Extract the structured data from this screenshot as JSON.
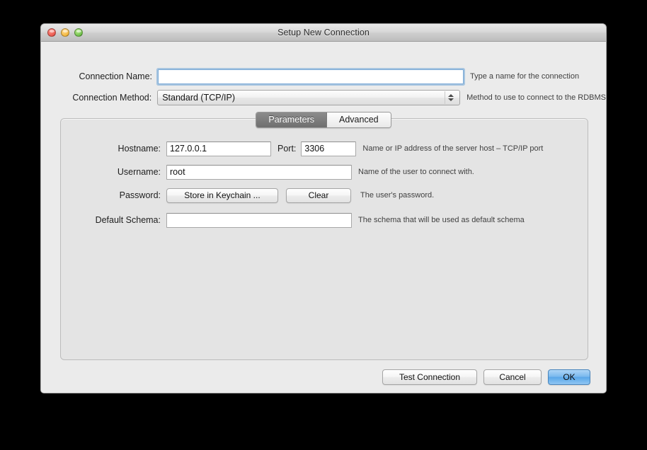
{
  "window": {
    "title": "Setup New Connection",
    "traffic_lights": [
      {
        "name": "close-button",
        "color": "#e9594f"
      },
      {
        "name": "minimize-button",
        "color": "#f3b73f"
      },
      {
        "name": "zoom-button",
        "color": "#6fc04a"
      }
    ]
  },
  "form": {
    "connection_name": {
      "label": "Connection Name:",
      "value": "",
      "placeholder": "",
      "hint": "Type a name for the connection"
    },
    "connection_method": {
      "label": "Connection Method:",
      "value": "Standard (TCP/IP)",
      "hint": "Method to use to connect to the RDBMS"
    }
  },
  "tabs": [
    {
      "label": "Parameters",
      "active": true
    },
    {
      "label": "Advanced",
      "active": false
    }
  ],
  "parameters": {
    "hostname": {
      "label": "Hostname:",
      "value": "127.0.0.1",
      "hint": "Name or IP address of the server host – TCP/IP port"
    },
    "port": {
      "label": "Port:",
      "value": "3306"
    },
    "username": {
      "label": "Username:",
      "value": "root",
      "hint": "Name of the user to connect with."
    },
    "password": {
      "label": "Password:",
      "store_button": "Store in Keychain ...",
      "clear_button": "Clear",
      "hint": "The user's password."
    },
    "default_schema": {
      "label": "Default Schema:",
      "value": "",
      "hint": "The schema that will be used as default schema"
    }
  },
  "footer": {
    "test_connection": "Test Connection",
    "cancel": "Cancel",
    "ok": "OK"
  },
  "colors": {
    "accent": "#5aa7e9",
    "focus_ring": "#76a9d8",
    "window_bg": "#ebebeb",
    "panel_bg": "#e4e4e4"
  }
}
